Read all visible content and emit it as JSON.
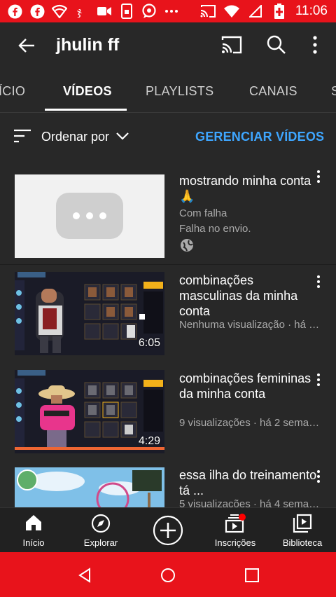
{
  "status_bar": {
    "time": "11:06",
    "left_icons": [
      "facebook-icon",
      "facebook-icon",
      "wifi-alert-icon",
      "app-icon",
      "video-camera-icon",
      "phone-lock-icon",
      "camera-chat-icon",
      "more-dots-icon"
    ],
    "right_icons": [
      "cast-icon",
      "wifi-icon",
      "signal-icon",
      "battery-charging-icon"
    ],
    "color": "#e8131b"
  },
  "app_bar": {
    "title": "jhulin ff"
  },
  "tabs": [
    {
      "label": "ÍCIO",
      "active": false
    },
    {
      "label": "VÍDEOS",
      "active": true
    },
    {
      "label": "PLAYLISTS",
      "active": false
    },
    {
      "label": "CANAIS",
      "active": false
    },
    {
      "label": "S",
      "active": false
    }
  ],
  "filter": {
    "sort_label": "Ordenar por",
    "manage_label": "GERENCIAR VÍDEOS",
    "accent": "#3ea6ff"
  },
  "videos": [
    {
      "title": "mostrando minha conta 🙏",
      "meta1": "Com falha",
      "meta2": "Falha no envio.",
      "duration": "",
      "thumb": "processing"
    },
    {
      "title": "combinações masculinas da minha conta",
      "meta1": "Nenhuma visualização · há …",
      "duration": "6:05",
      "thumb": "game-male"
    },
    {
      "title": "combinações femininas da minha conta",
      "meta1": "9 visualizações · há 2 sema…",
      "duration": "4:29",
      "thumb": "game-female"
    },
    {
      "title": "essa ilha do treinamento tá ...",
      "meta1": "5 visualizações · há 4 sema…",
      "duration": "",
      "thumb": "game-island"
    }
  ],
  "bottom_nav": [
    {
      "label": "Início",
      "icon": "home-icon"
    },
    {
      "label": "Explorar",
      "icon": "compass-icon"
    },
    {
      "label": "",
      "icon": "add-circle-icon"
    },
    {
      "label": "Inscrições",
      "icon": "subscriptions-icon"
    },
    {
      "label": "Biblioteca",
      "icon": "library-icon"
    }
  ]
}
